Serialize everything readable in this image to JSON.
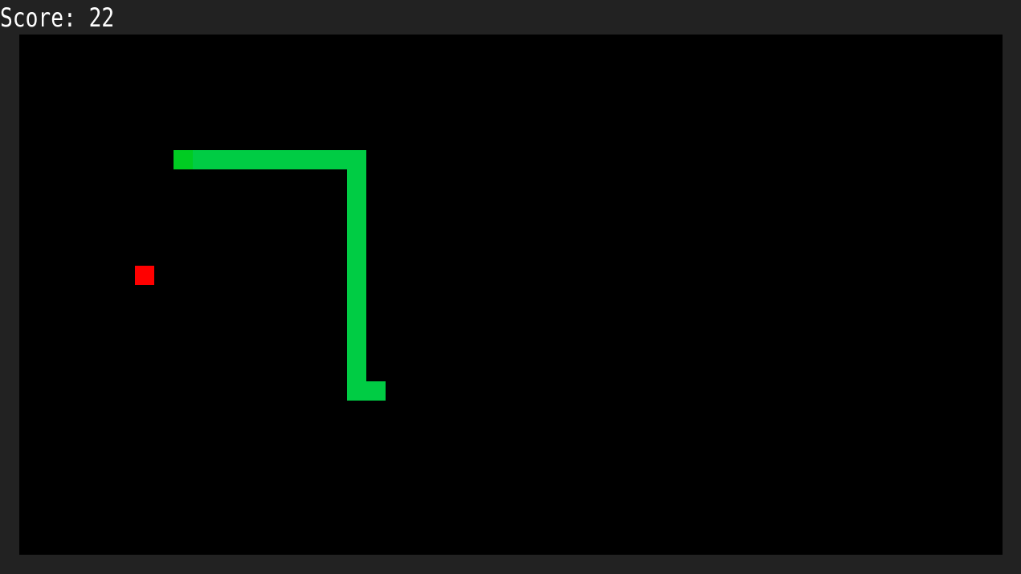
{
  "score": {
    "text": "Score: 22"
  },
  "colors": {
    "background": "#222222",
    "board": "#000000",
    "snake_head": "#00cc22",
    "snake_body": "#00cc44",
    "food": "#ff0000",
    "text": "#ffffff"
  },
  "board": {
    "columns": 51,
    "rows": 27
  },
  "snake": {
    "head": [
      8,
      6
    ],
    "body": [
      [
        9,
        6
      ],
      [
        10,
        6
      ],
      [
        11,
        6
      ],
      [
        12,
        6
      ],
      [
        13,
        6
      ],
      [
        14,
        6
      ],
      [
        15,
        6
      ],
      [
        16,
        6
      ],
      [
        17,
        6
      ],
      [
        17,
        7
      ],
      [
        17,
        8
      ],
      [
        17,
        9
      ],
      [
        17,
        10
      ],
      [
        17,
        11
      ],
      [
        17,
        12
      ],
      [
        17,
        13
      ],
      [
        17,
        14
      ],
      [
        17,
        15
      ],
      [
        17,
        16
      ],
      [
        17,
        17
      ],
      [
        17,
        18
      ],
      [
        18,
        18
      ]
    ]
  },
  "food": [
    6,
    12
  ]
}
